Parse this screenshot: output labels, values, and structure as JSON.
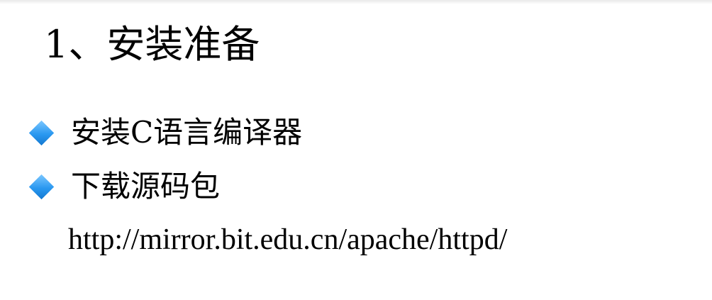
{
  "slide": {
    "title": "1、安装准备",
    "bullets": [
      {
        "icon": "diamond-bullet-icon",
        "text": "安装C语言编译器"
      },
      {
        "icon": "diamond-bullet-icon",
        "text": "下载源码包"
      }
    ],
    "url": "http://mirror.bit.edu.cn/apache/httpd/",
    "bullet_color": "#2a98f0"
  }
}
